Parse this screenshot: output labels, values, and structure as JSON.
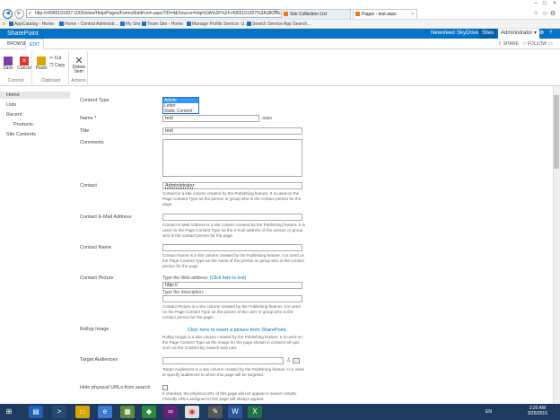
{
  "browser": {
    "url": "http://r4965191007:1000/sites/Help/Pages/Forms/EditForm.aspx?ID=4&Source=http%3A%2F%2Fr4965191007%3A1000%2...",
    "tabs": [
      {
        "label": "Site Collection List"
      },
      {
        "label": "Pages - test.aspx"
      }
    ],
    "favorites": [
      "AppCatalog - Home",
      "Home - Central Administr...",
      "My Site",
      "Team Site - Home",
      "Manage Profile Service: U...",
      "Search Service App Search..."
    ]
  },
  "suitebar": {
    "brand": "SharePoint",
    "links": [
      "Newsfeed",
      "SkyDrive",
      "Sites"
    ],
    "user": "Administrator"
  },
  "ribbon": {
    "tabs": [
      "BROWSE",
      "EDIT"
    ],
    "actions": [
      "SHARE",
      "FOLLOW"
    ],
    "groups": {
      "commit": {
        "label": "Commit",
        "save": "Save",
        "cancel": "Cancel"
      },
      "clipboard": {
        "label": "Clipboard",
        "paste": "Paste",
        "cut": "Cut",
        "copy": "Copy"
      },
      "actions": {
        "label": "Actions",
        "delete": "Delete Item"
      }
    }
  },
  "leftnav": {
    "items": [
      "Home",
      "Lists",
      "Recent",
      "Products",
      "Site Contents"
    ]
  },
  "form": {
    "content_type": {
      "label": "Content Type",
      "options": [
        "Article",
        "Letter",
        "Static Content"
      ]
    },
    "name": {
      "label": "Name *",
      "value": "test",
      "suffix": ".aspx"
    },
    "title": {
      "label": "Title",
      "value": "test"
    },
    "comments": {
      "label": "Comments"
    },
    "contact": {
      "label": "Contact",
      "value": "Administrator",
      "value_suffix": ";",
      "description": "Contact is a site column created by the Publishing feature. It is used on the Page Content Type as the person or group who is the contact person for the page."
    },
    "contact_email": {
      "label": "Contact E-Mail Address",
      "description": "Contact E-Mail Address is a site column created by the Publishing feature. It is used on the Page Content Type as the e-mail address of the person or group who is the contact person for the page."
    },
    "contact_name": {
      "label": "Contact Name",
      "description": "Contact Name is a site column created by the Publishing feature. It is used on the Page Content Type as the name of the person or group who is the contact person for the page."
    },
    "contact_picture": {
      "label": "Contact Picture",
      "web_address_label": "Type the Web address:",
      "web_address_link": "(Click here to test)",
      "url_value": "http://",
      "description_label": "Type the description:",
      "description": "Contact Picture is a site column created by the Publishing feature. It is used on the Page Content Type as the picture of the user or group who is the contact person for the page."
    },
    "rollup_image": {
      "label": "Rollup Image",
      "link": "Click here to insert a picture from SharePoint.",
      "description": "Rollup Image is a site column created by the Publishing feature. It is used on the Page Content Type as the image for the page shown in content roll-ups such as the Content By Search web part."
    },
    "target_audiences": {
      "label": "Target Audiences",
      "description": "Target Audiences is a site column created by the Publishing feature. It is used to specify audiences to which this page will be targeted."
    },
    "hide_urls": {
      "label": "Hide physical URLs from search",
      "checked": false,
      "description": "If checked, the physical URL of this page will not appear in search results. Friendly URLs assigned to this page will always appear."
    }
  },
  "taskbar": {
    "time": "3:20 AM",
    "date": "3/26/2015",
    "lang": "EN"
  },
  "colors": {
    "suite_blue": "#0072c6",
    "taskbar": "#1e3a5f",
    "selection": "#3399ff"
  }
}
